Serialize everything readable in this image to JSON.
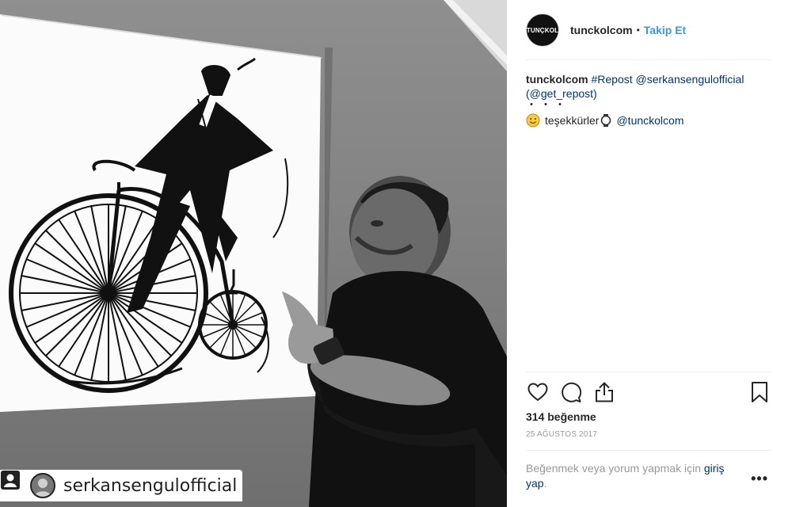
{
  "post": {
    "username": "tunckolcom",
    "logo_text": "TUNÇKOL",
    "separator": "•",
    "follow_label": "Takip Et",
    "caption": {
      "username": "tunckolcom",
      "hashtag": "#Repost",
      "mention": "@serkansengulofficial",
      "via": "(@get_repost)",
      "dots": "・・・",
      "thanks": "teşekkürler",
      "mention2": "@tunckolcom"
    },
    "likes": "314 beğenme",
    "date": "25 AĞUSTOS 2017",
    "login_prompt": {
      "before": "Beğenmek veya yorum yapmak için ",
      "link": "giriş yap",
      "after": "."
    },
    "more_label": "•••"
  },
  "photo": {
    "repost_name": "serkansengulofficial"
  },
  "icons": {
    "like": "heart-icon",
    "comment": "comment-icon",
    "share": "share-icon",
    "save": "bookmark-icon",
    "repost": "repost-icon"
  },
  "colors": {
    "link": "#003569",
    "follow": "#3897f0",
    "muted": "#999999"
  }
}
